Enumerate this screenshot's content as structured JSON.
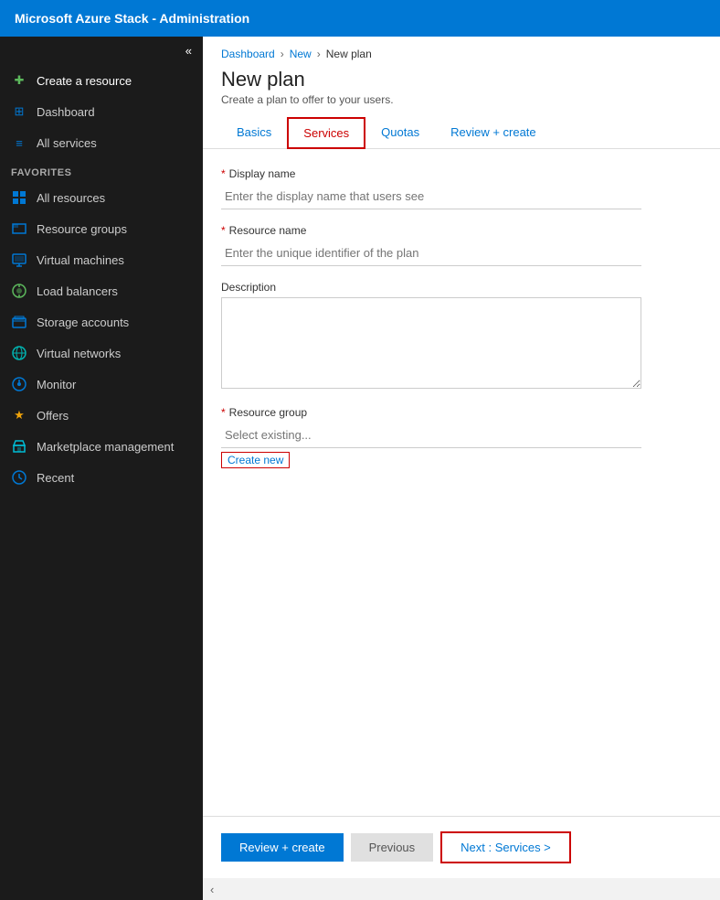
{
  "topbar": {
    "title": "Microsoft Azure Stack - Administration"
  },
  "sidebar": {
    "collapse_icon": "«",
    "items": [
      {
        "id": "create-resource",
        "label": "Create a resource",
        "icon": "+",
        "icon_color": "icon-green"
      },
      {
        "id": "dashboard",
        "label": "Dashboard",
        "icon": "⊞",
        "icon_color": "icon-blue"
      },
      {
        "id": "all-services",
        "label": "All services",
        "icon": "≡",
        "icon_color": "icon-blue"
      },
      {
        "id": "favorites-label",
        "label": "FAVORITES",
        "type": "section"
      },
      {
        "id": "all-resources",
        "label": "All resources",
        "icon": "▦",
        "icon_color": "icon-blue"
      },
      {
        "id": "resource-groups",
        "label": "Resource groups",
        "icon": "◫",
        "icon_color": "icon-blue"
      },
      {
        "id": "virtual-machines",
        "label": "Virtual machines",
        "icon": "▣",
        "icon_color": "icon-blue"
      },
      {
        "id": "load-balancers",
        "label": "Load balancers",
        "icon": "⊕",
        "icon_color": "icon-green"
      },
      {
        "id": "storage-accounts",
        "label": "Storage accounts",
        "icon": "▤",
        "icon_color": "icon-blue"
      },
      {
        "id": "virtual-networks",
        "label": "Virtual networks",
        "icon": "⊛",
        "icon_color": "icon-teal"
      },
      {
        "id": "monitor",
        "label": "Monitor",
        "icon": "◎",
        "icon_color": "icon-blue"
      },
      {
        "id": "offers",
        "label": "Offers",
        "icon": "★",
        "icon_color": "icon-yellow"
      },
      {
        "id": "marketplace-management",
        "label": "Marketplace management",
        "icon": "⊙",
        "icon_color": "icon-cyan"
      },
      {
        "id": "recent",
        "label": "Recent",
        "icon": "◷",
        "icon_color": "icon-blue"
      }
    ]
  },
  "breadcrumb": {
    "items": [
      "Dashboard",
      "New",
      "New plan"
    ]
  },
  "page": {
    "title": "New plan",
    "subtitle": "Create a plan to offer to your users."
  },
  "tabs": [
    {
      "id": "basics",
      "label": "Basics",
      "active": false
    },
    {
      "id": "services",
      "label": "Services",
      "active": true
    },
    {
      "id": "quotas",
      "label": "Quotas",
      "active": false
    },
    {
      "id": "review-create",
      "label": "Review + create",
      "active": false
    }
  ],
  "form": {
    "display_name_label": "Display name",
    "display_name_placeholder": "Enter the display name that users see",
    "resource_name_label": "Resource name",
    "resource_name_placeholder": "Enter the unique identifier of the plan",
    "description_label": "Description",
    "resource_group_label": "Resource group",
    "resource_group_placeholder": "Select existing...",
    "create_new_label": "Create new"
  },
  "footer": {
    "review_create_label": "Review + create",
    "previous_label": "Previous",
    "next_label": "Next : Services >"
  },
  "bottom_bar": {
    "collapse_icon": "‹"
  }
}
